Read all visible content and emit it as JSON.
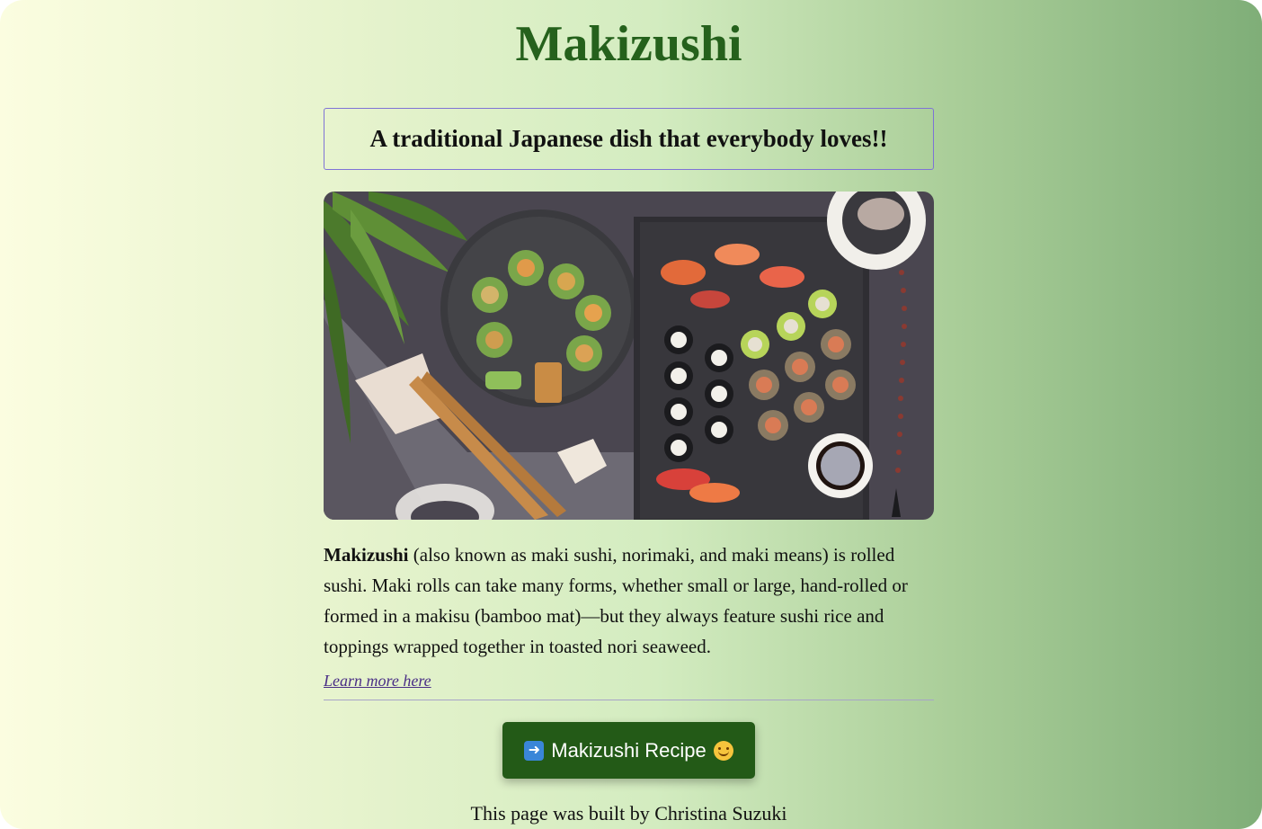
{
  "page": {
    "title": "Makizushi",
    "tagline": "A traditional Japanese dish that everybody loves!!",
    "image_alt": "Makizushi platter with sushi rolls and chopsticks",
    "description_bold": "Makizushi",
    "description_rest": " (also known as maki sushi, norimaki, and maki means) is rolled sushi. Maki rolls can take many forms, whether small or large, hand-rolled or formed in a makisu (bamboo mat)—but they always feature sushi rice and toppings wrapped together in toasted nori seaweed.",
    "learn_more": "Learn more here",
    "recipe_button": "Makizushi Recipe",
    "footer": "This page was built by Christina Suzuki"
  },
  "colors": {
    "heading": "#25611c",
    "button": "#235a17",
    "link": "#4a2f86",
    "tagline_border": "#7f73d6"
  },
  "icons": {
    "button_left": "right-arrow-icon",
    "button_right": "smiling-face-icon"
  }
}
